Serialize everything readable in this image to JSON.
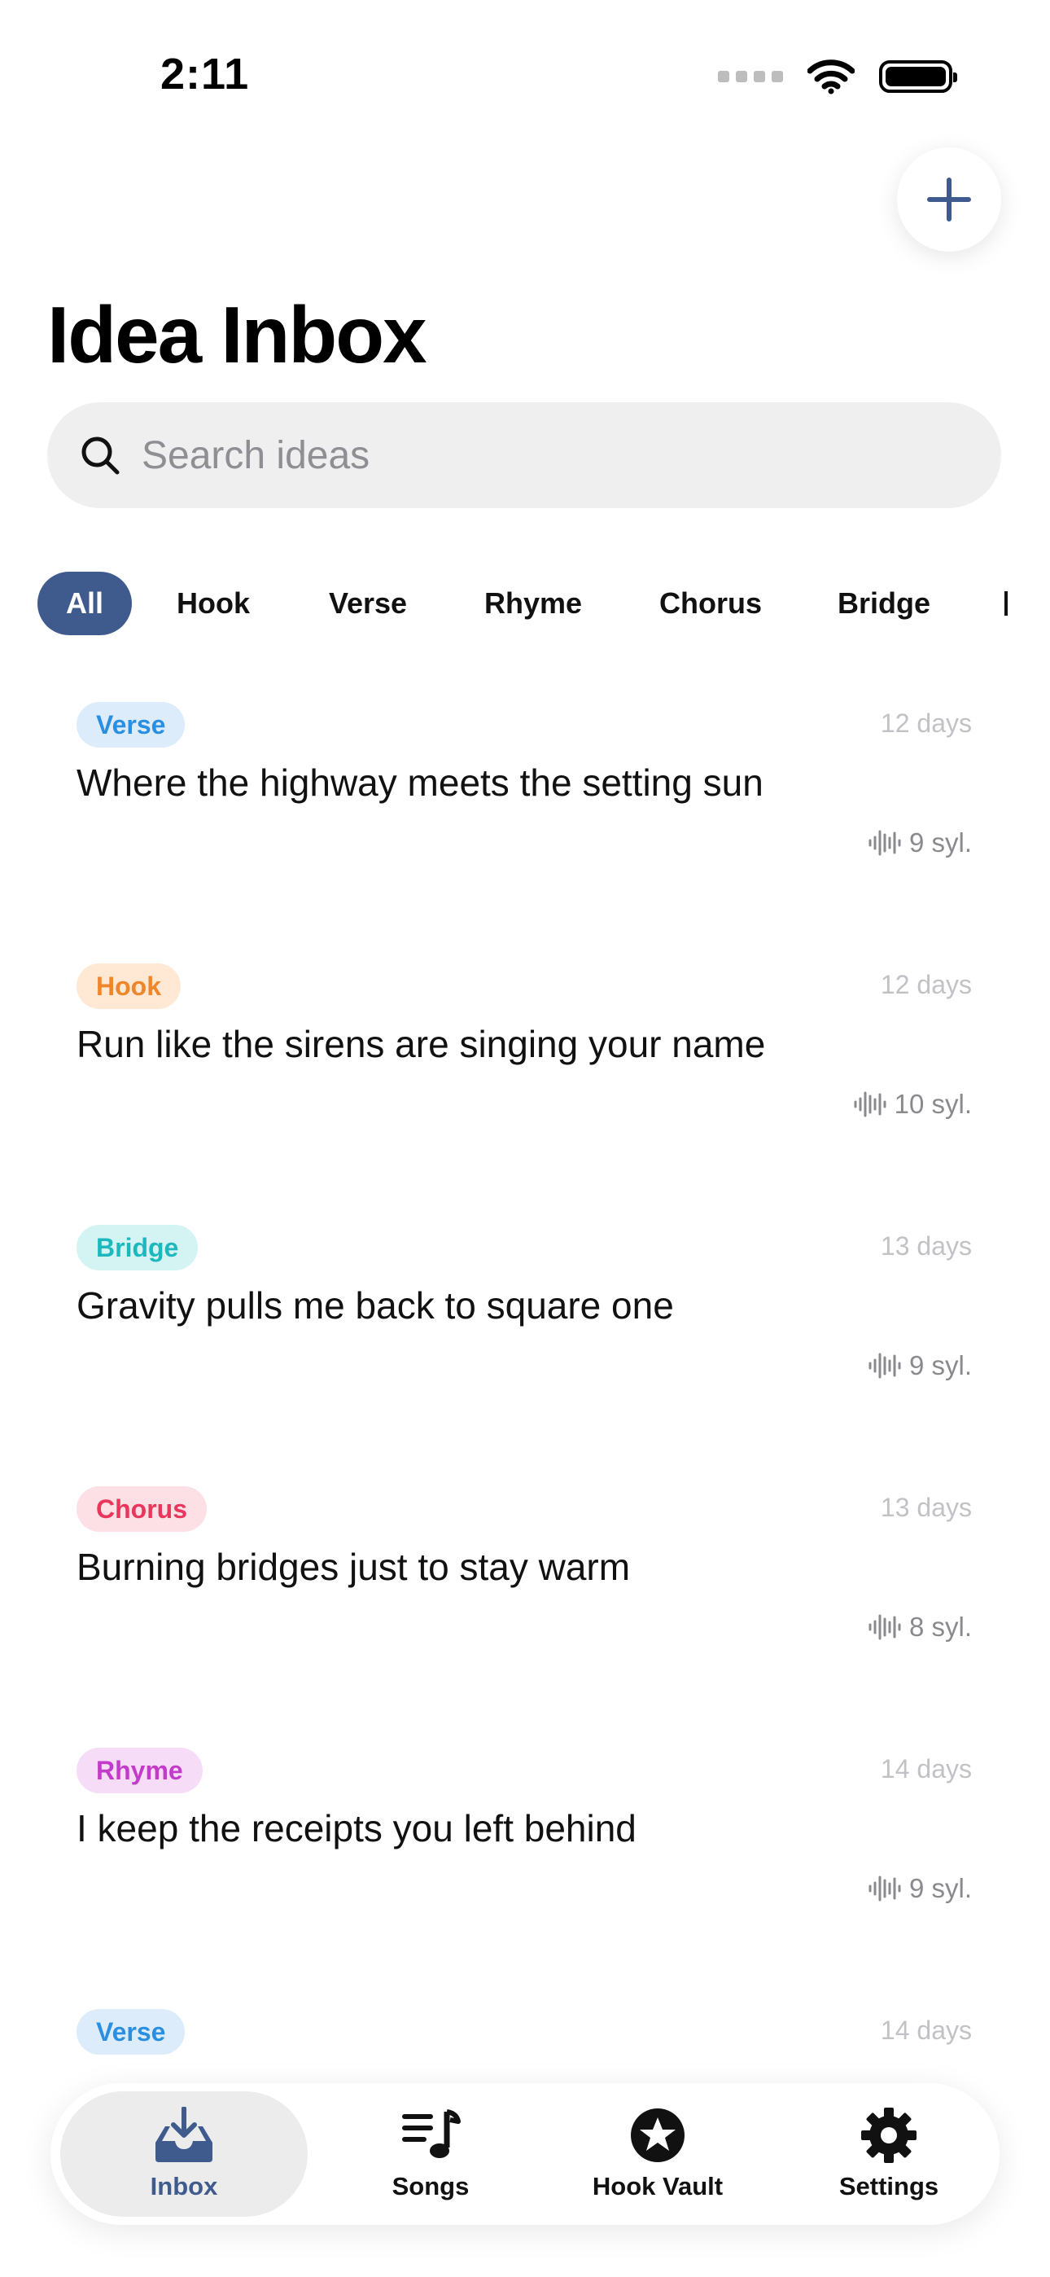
{
  "status_bar": {
    "time": "2:11"
  },
  "header": {
    "title": "Idea Inbox"
  },
  "search": {
    "placeholder": "Search ideas"
  },
  "filters": [
    {
      "label": "All",
      "active": true
    },
    {
      "label": "Hook",
      "active": false
    },
    {
      "label": "Verse",
      "active": false
    },
    {
      "label": "Rhyme",
      "active": false
    },
    {
      "label": "Chorus",
      "active": false
    },
    {
      "label": "Bridge",
      "active": false
    }
  ],
  "ideas": [
    {
      "tag": "Verse",
      "text": "Where the highway meets the setting sun",
      "age": "12 days",
      "syllables": "9 syl."
    },
    {
      "tag": "Hook",
      "text": "Run like the sirens are singing your name",
      "age": "12 days",
      "syllables": "10 syl."
    },
    {
      "tag": "Bridge",
      "text": "Gravity pulls me back to square one",
      "age": "13 days",
      "syllables": "9 syl."
    },
    {
      "tag": "Chorus",
      "text": "Burning bridges just to stay warm",
      "age": "13 days",
      "syllables": "8 syl."
    },
    {
      "tag": "Rhyme",
      "text": "I keep the receipts you left behind",
      "age": "14 days",
      "syllables": "9 syl."
    },
    {
      "tag": "Verse",
      "text": "",
      "age": "14 days",
      "syllables": ""
    }
  ],
  "tag_colors": {
    "Verse": {
      "bg": "#dcecfb",
      "fg": "#2a8fe0"
    },
    "Hook": {
      "bg": "#ffe8d4",
      "fg": "#f0862a"
    },
    "Bridge": {
      "bg": "#d4f4f4",
      "fg": "#1cb8bd"
    },
    "Chorus": {
      "bg": "#fde0e6",
      "fg": "#e8365c"
    },
    "Rhyme": {
      "bg": "#f6dcf7",
      "fg": "#c23bc9"
    }
  },
  "tab_bar": {
    "tabs": [
      {
        "label": "Inbox",
        "icon": "inbox-icon",
        "active": true
      },
      {
        "label": "Songs",
        "icon": "music-list-icon",
        "active": false
      },
      {
        "label": "Hook Vault",
        "icon": "star-icon",
        "active": false
      },
      {
        "label": "Settings",
        "icon": "gear-icon",
        "active": false
      }
    ]
  },
  "colors": {
    "accent": "#3f5b8e"
  }
}
